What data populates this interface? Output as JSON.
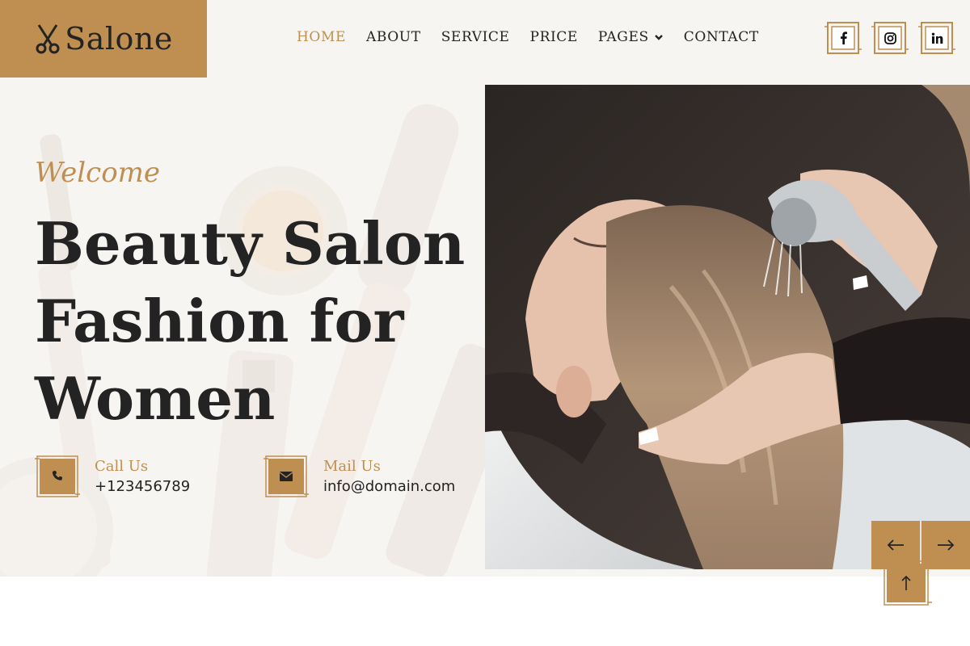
{
  "brand": {
    "name": "Salone",
    "icon": "scissors-icon"
  },
  "nav": {
    "items": [
      {
        "label": "HOME",
        "active": true
      },
      {
        "label": "ABOUT",
        "active": false
      },
      {
        "label": "SERVICE",
        "active": false
      },
      {
        "label": "PRICE",
        "active": false
      },
      {
        "label": "PAGES",
        "active": false,
        "has_dropdown": true
      },
      {
        "label": "CONTACT",
        "active": false
      }
    ]
  },
  "socials": [
    {
      "name": "facebook",
      "glyph": "f"
    },
    {
      "name": "instagram",
      "glyph": "◎"
    },
    {
      "name": "linkedin",
      "glyph": "in"
    }
  ],
  "hero": {
    "welcome": "Welcome",
    "title": "Beauty Salon Fashion for Women",
    "call": {
      "label": "Call Us",
      "value": "+123456789",
      "icon": "phone-icon"
    },
    "mail": {
      "label": "Mail Us",
      "value": "info@domain.com",
      "icon": "envelope-icon"
    }
  },
  "carousel": {
    "prev_icon": "arrow-left-icon",
    "next_icon": "arrow-right-icon"
  },
  "back_to_top": {
    "icon": "arrow-up-icon"
  },
  "colors": {
    "accent": "#bf8f52",
    "dark": "#232323",
    "background": "#f7f5f2"
  }
}
